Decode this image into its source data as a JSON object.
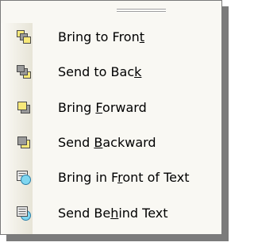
{
  "menu": {
    "items": [
      {
        "id": "bring-to-front",
        "before": "Bring to Fron",
        "mnemonic": "t",
        "after": "",
        "icon": "bring-to-front-icon"
      },
      {
        "id": "send-to-back",
        "before": "Send to Bac",
        "mnemonic": "k",
        "after": "",
        "icon": "send-to-back-icon"
      },
      {
        "id": "bring-forward",
        "before": "Bring ",
        "mnemonic": "F",
        "after": "orward",
        "icon": "bring-forward-icon"
      },
      {
        "id": "send-backward",
        "before": "Send ",
        "mnemonic": "B",
        "after": "ackward",
        "icon": "send-backward-icon"
      },
      {
        "id": "bring-in-front-of-text",
        "before": "Bring in F",
        "mnemonic": "r",
        "after": "ont of Text",
        "icon": "bring-in-front-of-text-icon"
      },
      {
        "id": "send-behind-text",
        "before": "Send Be",
        "mnemonic": "h",
        "after": "ind Text",
        "icon": "send-behind-text-icon"
      }
    ]
  },
  "colors": {
    "yellow": "#f7e87a",
    "grey": "#9a9a9a",
    "cyan": "#7fd6f0",
    "outline": "#4a4a4a"
  }
}
